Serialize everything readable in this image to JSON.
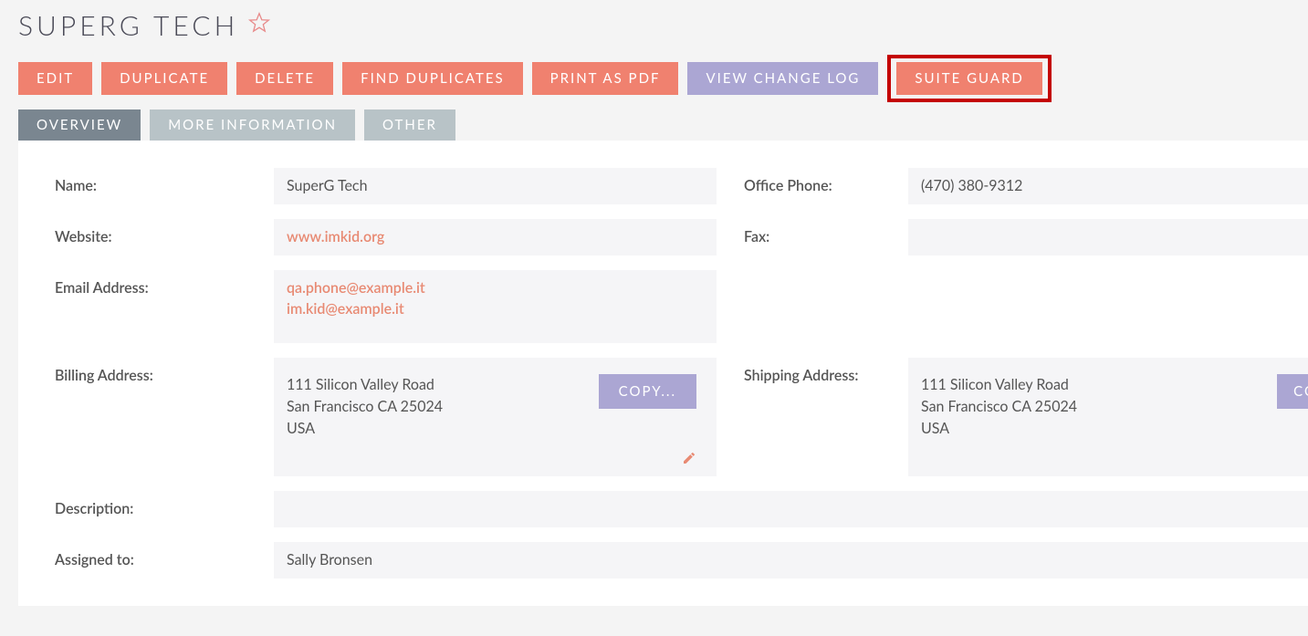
{
  "title": "SUPERG TECH",
  "actions": {
    "edit": "EDIT",
    "duplicate": "DUPLICATE",
    "delete": "DELETE",
    "find_duplicates": "FIND DUPLICATES",
    "print_pdf": "PRINT AS PDF",
    "view_change_log": "VIEW CHANGE LOG",
    "suite_guard": "SUITE GUARD"
  },
  "tabs": {
    "overview": "OVERVIEW",
    "more_info": "MORE INFORMATION",
    "other": "OTHER"
  },
  "fields": {
    "name": {
      "label": "Name:",
      "value": "SuperG Tech"
    },
    "office_phone": {
      "label": "Office Phone:",
      "value": "(470) 380-9312"
    },
    "website": {
      "label": "Website:",
      "value": "www.imkid.org"
    },
    "fax": {
      "label": "Fax:",
      "value": ""
    },
    "email": {
      "label": "Email Address:",
      "values": [
        "qa.phone@example.it",
        "im.kid@example.it"
      ]
    },
    "billing": {
      "label": "Billing Address:",
      "line1": "111 Silicon Valley Road",
      "line2": "San Francisco CA   25024",
      "line3": "USA",
      "copy": "COPY..."
    },
    "shipping": {
      "label": "Shipping Address:",
      "line1": "111 Silicon Valley Road",
      "line2": "San Francisco CA   25024",
      "line3": "USA",
      "copy": "CO"
    },
    "description": {
      "label": "Description:",
      "value": ""
    },
    "assigned": {
      "label": "Assigned to:",
      "value": "Sally Bronsen"
    }
  }
}
